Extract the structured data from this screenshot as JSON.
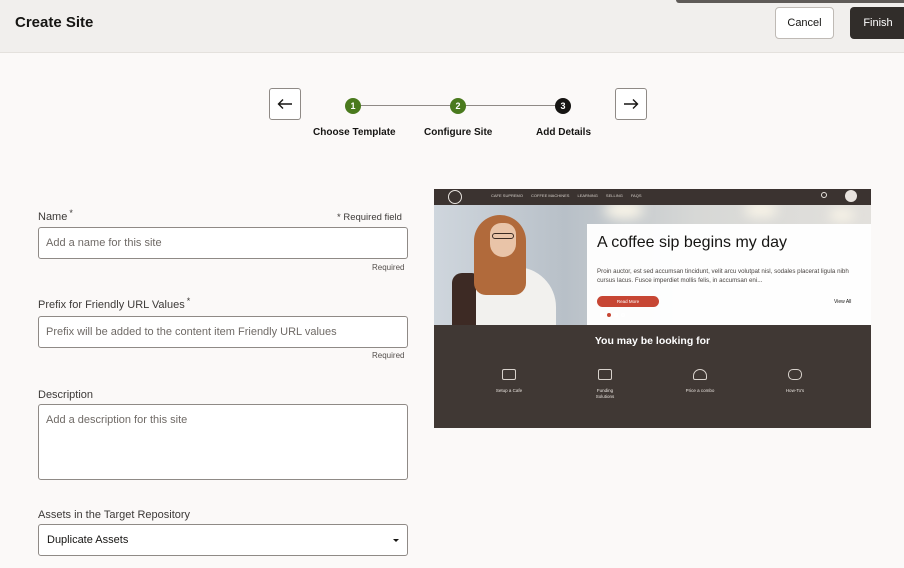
{
  "header": {
    "title": "Create Site",
    "cancel_label": "Cancel",
    "finish_label": "Finish"
  },
  "stepper": {
    "prev_icon": "arrow-left-icon",
    "next_icon": "arrow-right-icon",
    "steps": [
      {
        "number": "1",
        "label": "Choose Template",
        "status": "complete",
        "color": "#4a7a1e"
      },
      {
        "number": "2",
        "label": "Configure Site",
        "status": "complete",
        "color": "#4a7a1e"
      },
      {
        "number": "3",
        "label": "Add Details",
        "status": "current",
        "color": "#161513"
      }
    ]
  },
  "form": {
    "required_note": "* Required field",
    "name": {
      "label": "Name",
      "asterisk": "*",
      "placeholder": "Add a name for this site",
      "value": "",
      "hint": "Required"
    },
    "prefix": {
      "label": "Prefix for Friendly URL Values",
      "asterisk": "*",
      "placeholder": "Prefix will be added to the content item Friendly URL values",
      "value": "",
      "hint": "Required"
    },
    "description": {
      "label": "Description",
      "placeholder": "Add a description for this site",
      "value": ""
    },
    "assets": {
      "label": "Assets in the Target Repository",
      "selected": "Duplicate Assets"
    }
  },
  "preview": {
    "nav_items": [
      "Cafe Supremo",
      "Coffee Machines",
      "Learning",
      "Selling",
      "FAQs"
    ],
    "hero_title": "A coffee sip begins my day",
    "hero_body": "Proin auctor, est sed accumsan tincidunt, velit arcu volutpat nisl, sodales placerat ligula nibh cursus lacus. Fusce imperdiet mollis felis, in accumsan eni...",
    "read_more": "Read More",
    "view_all": "View All",
    "section_title": "You may be looking for",
    "features": [
      "Setup a Cafe",
      "Funding Solutions",
      "Price a combo",
      "How-To's"
    ]
  },
  "colors": {
    "accent": "#c74634",
    "step_complete": "#4a7a1e",
    "dark_button": "#312d2a"
  }
}
